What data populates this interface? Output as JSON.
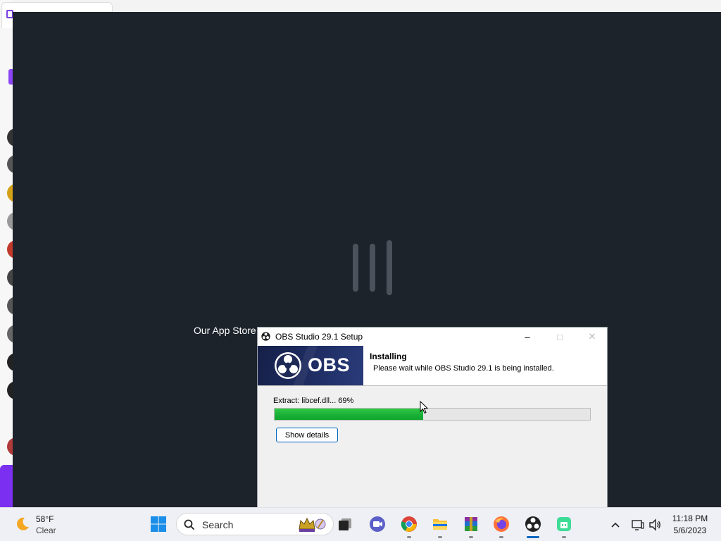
{
  "background_app": {
    "overlay_text": "Our App Store"
  },
  "installer": {
    "window_title": "OBS Studio 29.1 Setup",
    "banner_text": "OBS",
    "header_title": "Installing",
    "header_subtitle": "Please wait while OBS Studio 29.1 is being installed.",
    "status_text": "Extract: libcef.dll... 69%",
    "progress": 0.47,
    "show_details_label": "Show details",
    "caption_buttons": {
      "minimize": "–",
      "maximize": "□",
      "close": "✕"
    }
  },
  "taskbar": {
    "weather": {
      "temperature": "58°F",
      "condition": "Clear",
      "icon": "moon-icon"
    },
    "search_placeholder": "Search",
    "apps": [
      {
        "name": "task-view",
        "icon": "task-view-icon"
      },
      {
        "name": "meet",
        "icon": "meet-icon"
      },
      {
        "name": "chrome",
        "icon": "chrome-icon"
      },
      {
        "name": "file-explorer",
        "icon": "folder-icon"
      },
      {
        "name": "winrar",
        "icon": "winrar-icon"
      },
      {
        "name": "firefox",
        "icon": "firefox-icon"
      },
      {
        "name": "obs",
        "icon": "obs-icon"
      },
      {
        "name": "installer",
        "icon": "installer-icon"
      }
    ],
    "clock": {
      "time": "11:18 PM",
      "date": "5/6/2023"
    }
  },
  "colors": {
    "overlay": "#1d232b",
    "progress_fill": "#1db23a",
    "banner": "#1e2d63",
    "accent": "#0067c0"
  }
}
